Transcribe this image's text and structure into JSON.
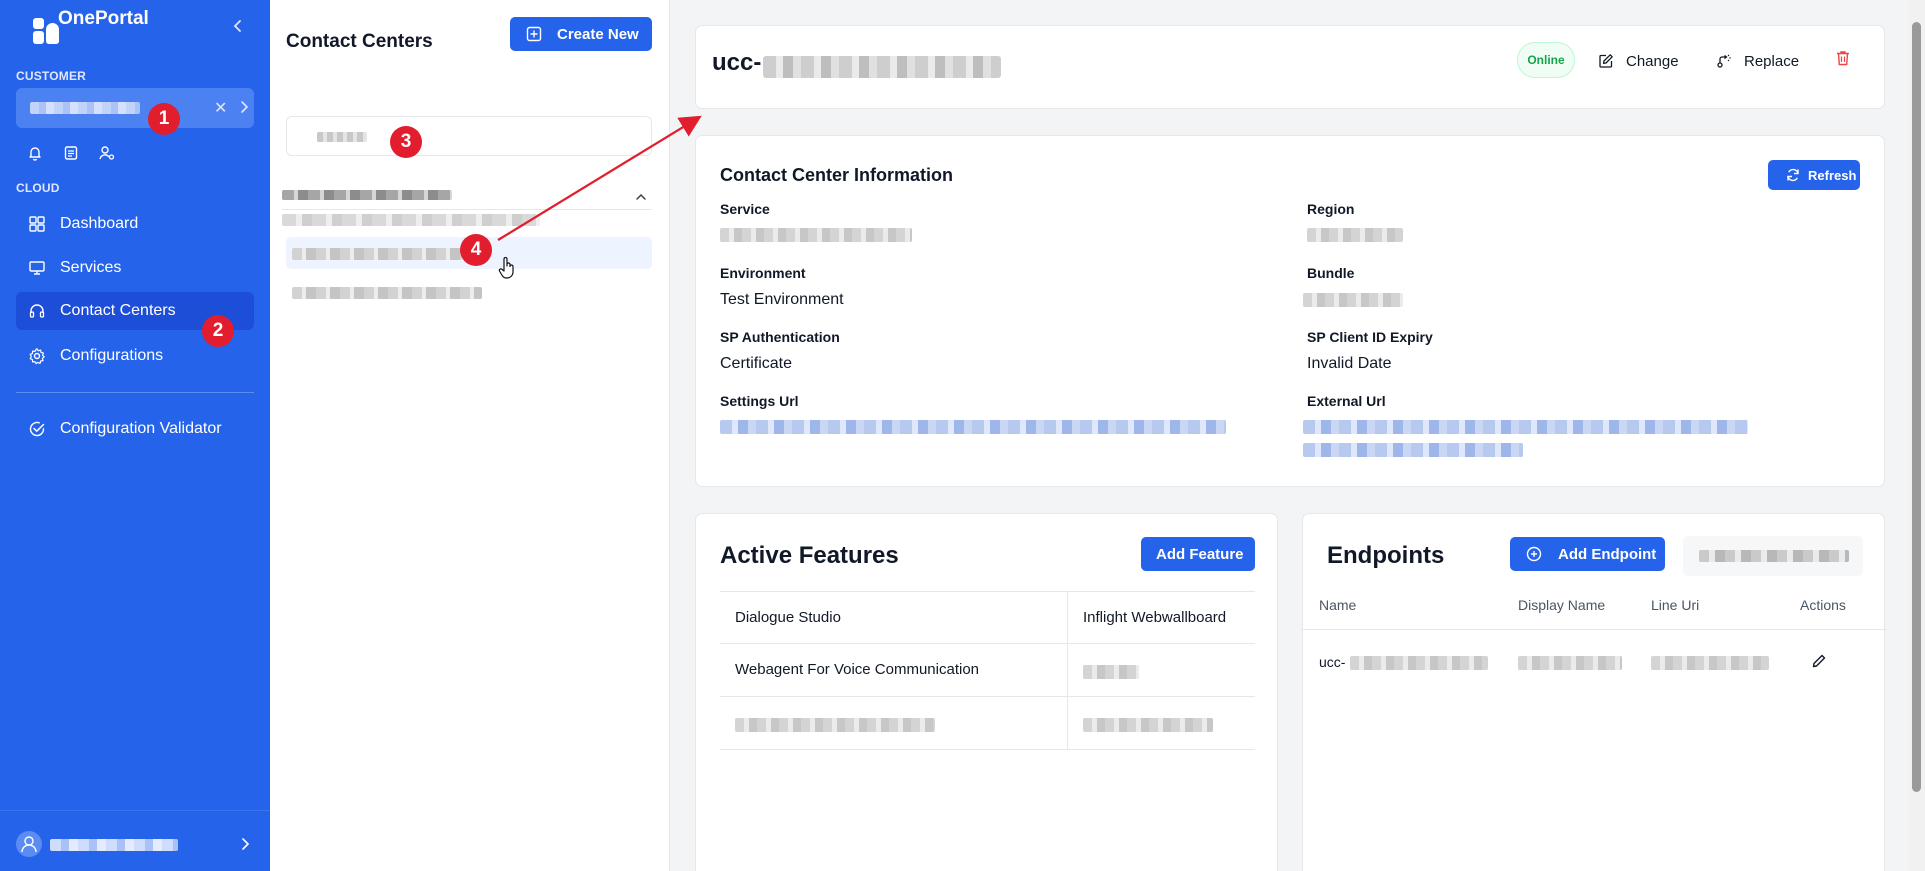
{
  "app": {
    "name": "OnePortal"
  },
  "sidebar": {
    "customer_label": "CUSTOMER",
    "cloud_label": "CLOUD",
    "customer_clear": "✕",
    "items": [
      {
        "label": "Dashboard",
        "icon": "dashboard-icon"
      },
      {
        "label": "Services",
        "icon": "monitor-icon"
      },
      {
        "label": "Contact Centers",
        "icon": "headset-icon",
        "active": true
      },
      {
        "label": "Configurations",
        "icon": "gear-icon"
      },
      {
        "label": "Configuration Validator",
        "icon": "check-circle-icon"
      }
    ]
  },
  "list_panel": {
    "title": "Contact Centers",
    "create_label": "Create New"
  },
  "annotations": [
    "1",
    "2",
    "3",
    "4"
  ],
  "header": {
    "name_prefix": "ucc-",
    "status": "Online",
    "change_label": "Change",
    "replace_label": "Replace"
  },
  "info": {
    "title": "Contact Center Information",
    "refresh_label": "Refresh",
    "labels": {
      "service": "Service",
      "region": "Region",
      "environment": "Environment",
      "bundle": "Bundle",
      "sp_auth": "SP Authentication",
      "sp_expiry": "SP Client ID Expiry",
      "settings_url": "Settings Url",
      "external_url": "External Url"
    },
    "values": {
      "environment": "Test Environment",
      "sp_auth": "Certificate",
      "sp_expiry": "Invalid Date"
    }
  },
  "features": {
    "title": "Active Features",
    "add_label": "Add Feature",
    "rows": [
      [
        "Dialogue Studio",
        "Inflight Webwallboard"
      ],
      [
        "Webagent For Voice Communication",
        ""
      ],
      [
        "",
        ""
      ]
    ]
  },
  "endpoints": {
    "title": "Endpoints",
    "add_label": "Add Endpoint",
    "columns": [
      "Name",
      "Display Name",
      "Line Uri",
      "Actions"
    ],
    "row_name_prefix": "ucc-"
  },
  "colors": {
    "primary": "#2563eb",
    "sidebar": "#2563eb",
    "badge": "#e11d2e",
    "online": "#16a34a"
  }
}
